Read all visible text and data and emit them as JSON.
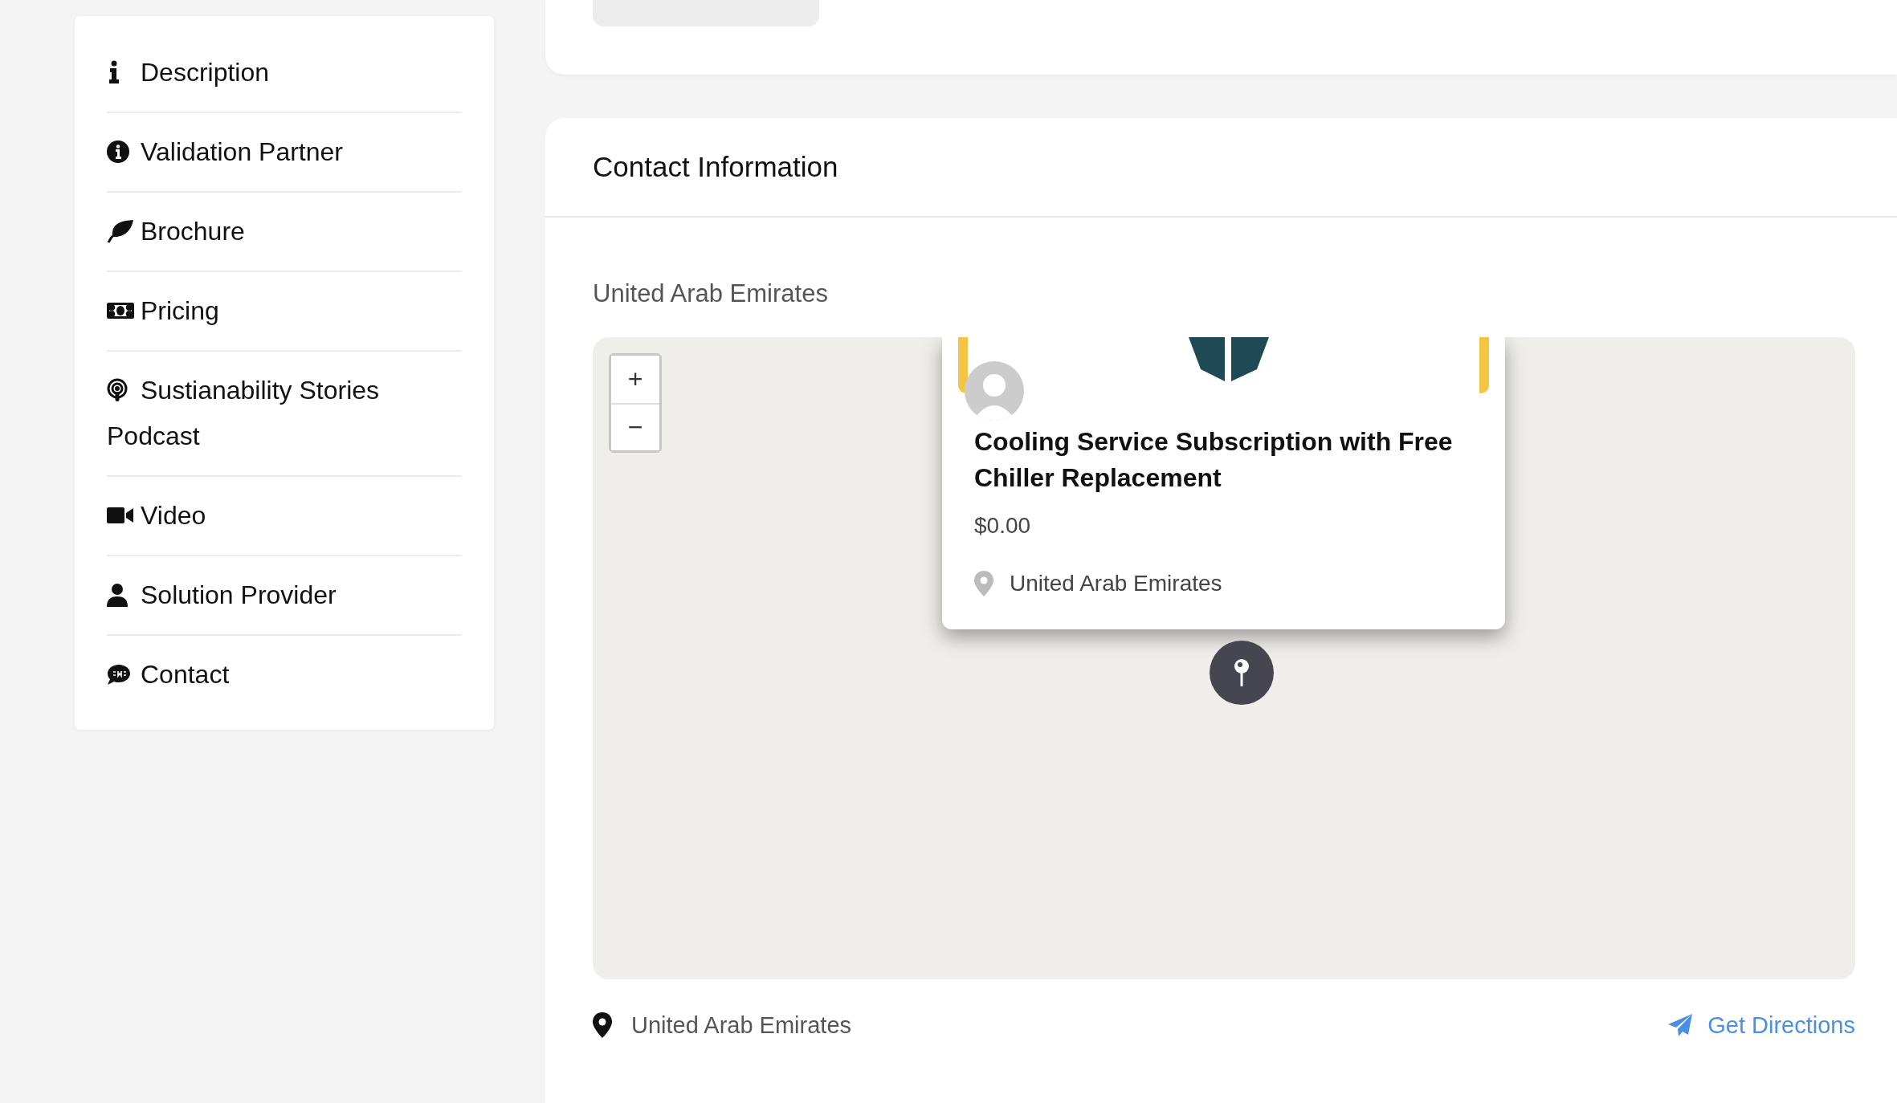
{
  "sidebar": {
    "items": [
      {
        "kind": "info",
        "label": "Description"
      },
      {
        "kind": "info-circle",
        "label": "Validation Partner"
      },
      {
        "kind": "leaf",
        "label": "Brochure"
      },
      {
        "kind": "money",
        "label": "Pricing"
      },
      {
        "kind": "podcast",
        "label": "Sustianability Stories Podcast"
      },
      {
        "kind": "video",
        "label": "Video"
      },
      {
        "kind": "user",
        "label": "Solution Provider"
      },
      {
        "kind": "sms",
        "label": "Contact"
      }
    ]
  },
  "contact": {
    "title": "Contact Information",
    "country": "United Arab Emirates",
    "map": {
      "zoom_in": "+",
      "zoom_out": "−",
      "popup": {
        "title": "Cooling Service Subscription with Free Chiller Replacement",
        "price": "$0.00",
        "location": "United Arab Emirates"
      }
    },
    "address": "United Arab Emirates",
    "directions": "Get Directions"
  }
}
